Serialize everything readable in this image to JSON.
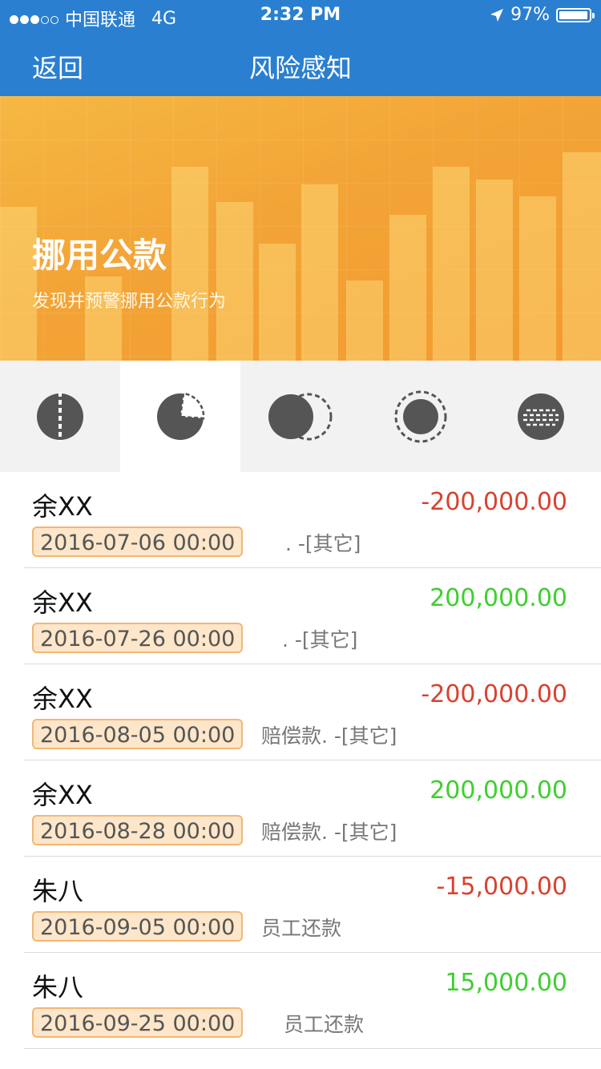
{
  "status_bar": {
    "carrier": "中国联通",
    "network": "4G",
    "time": "2:32 PM",
    "battery": "97%",
    "battery_level": 0.97
  },
  "nav": {
    "back_label": "返回",
    "title": "风险感知"
  },
  "banner": {
    "headline": "挪用公款",
    "subtitle": "发现并预警挪用公款行为"
  },
  "tabs": [
    {
      "icon": "split-circle-icon",
      "active": false
    },
    {
      "icon": "pie-slice-icon",
      "active": true
    },
    {
      "icon": "overlap-circles-icon",
      "active": false
    },
    {
      "icon": "dashed-ring-circle-icon",
      "active": false
    },
    {
      "icon": "dashes-circle-icon",
      "active": false
    }
  ],
  "colors": {
    "primary": "#2a7fd0",
    "negative": "#d9412e",
    "positive": "#3ecf2f",
    "date_bg": "#fde6c9",
    "date_border": "#f3b775"
  },
  "records": [
    {
      "name": "余XX",
      "amount": "-200,000.00",
      "sign": "neg",
      "date": "2016-07-06 00:00",
      "desc": ". -[其它]"
    },
    {
      "name": "余XX",
      "amount": "200,000.00",
      "sign": "pos",
      "date": "2016-07-26 00:00",
      "desc": ". -[其它]"
    },
    {
      "name": "余XX",
      "amount": "-200,000.00",
      "sign": "neg",
      "date": "2016-08-05 00:00",
      "desc": "赔偿款. -[其它]"
    },
    {
      "name": "余XX",
      "amount": "200,000.00",
      "sign": "pos",
      "date": "2016-08-28 00:00",
      "desc": "赔偿款. -[其它]"
    },
    {
      "name": "朱八",
      "amount": "-15,000.00",
      "sign": "neg",
      "date": "2016-09-05 00:00",
      "desc": "员工还款"
    },
    {
      "name": "朱八",
      "amount": "15,000.00",
      "sign": "pos",
      "date": "2016-09-25 00:00",
      "desc": "员工还款"
    }
  ]
}
